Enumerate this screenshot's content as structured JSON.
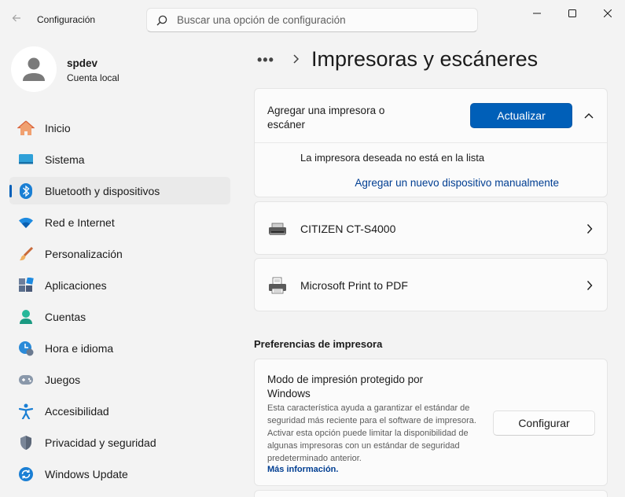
{
  "window": {
    "title": "Configuración",
    "back_icon": "back-arrow-icon",
    "minimize_icon": "minimize-icon",
    "maximize_icon": "maximize-icon",
    "close_icon": "close-icon"
  },
  "search": {
    "placeholder": "Buscar una opción de configuración",
    "icon": "search-icon"
  },
  "profile": {
    "name": "spdev",
    "account_type": "Cuenta local"
  },
  "sidebar": {
    "selected_index": 2,
    "accent": "#005fb8",
    "items": [
      {
        "label": "Inicio",
        "icon": "home-icon"
      },
      {
        "label": "Sistema",
        "icon": "system-icon"
      },
      {
        "label": "Bluetooth y dispositivos",
        "icon": "bluetooth-icon"
      },
      {
        "label": "Red e Internet",
        "icon": "wifi-icon"
      },
      {
        "label": "Personalización",
        "icon": "brush-icon"
      },
      {
        "label": "Aplicaciones",
        "icon": "apps-icon"
      },
      {
        "label": "Cuentas",
        "icon": "accounts-icon"
      },
      {
        "label": "Hora e idioma",
        "icon": "time-language-icon"
      },
      {
        "label": "Juegos",
        "icon": "gamepad-icon"
      },
      {
        "label": "Accesibilidad",
        "icon": "accessibility-icon"
      },
      {
        "label": "Privacidad y seguridad",
        "icon": "shield-icon"
      },
      {
        "label": "Windows Update",
        "icon": "update-icon"
      }
    ]
  },
  "header": {
    "breadcrumb_more": "•••",
    "title": "Impresoras y escáneres"
  },
  "add_printer": {
    "title": "Agregar una impresora o escáner",
    "refresh_button": "Actualizar",
    "not_listed": "La impresora deseada no está en la lista",
    "add_manual_link": "Agregar un nuevo dispositivo manualmente"
  },
  "printers": [
    {
      "name": "CITIZEN CT-S4000",
      "icon": "printer-icon"
    },
    {
      "name": "Microsoft Print to PDF",
      "icon": "pdf-printer-icon"
    }
  ],
  "preferences": {
    "section_title": "Preferencias de impresora",
    "protected_mode_title": "Modo de impresión protegido por Windows",
    "protected_mode_desc": "Esta característica ayuda a garantizar el estándar de seguridad más reciente para el software de impresora. Activar esta opción puede limitar la disponibilidad de algunas impresoras con un estándar de seguridad predeterminado anterior.",
    "more_info_link": "Más información.",
    "configure_button": "Configurar"
  }
}
